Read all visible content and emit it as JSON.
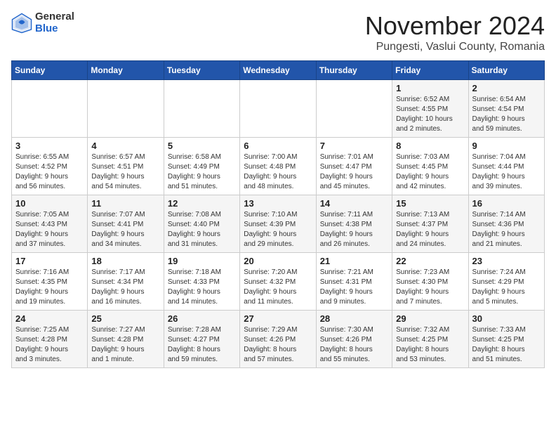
{
  "logo": {
    "general": "General",
    "blue": "Blue"
  },
  "title": "November 2024",
  "location": "Pungesti, Vaslui County, Romania",
  "weekdays": [
    "Sunday",
    "Monday",
    "Tuesday",
    "Wednesday",
    "Thursday",
    "Friday",
    "Saturday"
  ],
  "weeks": [
    [
      {
        "day": "",
        "info": ""
      },
      {
        "day": "",
        "info": ""
      },
      {
        "day": "",
        "info": ""
      },
      {
        "day": "",
        "info": ""
      },
      {
        "day": "",
        "info": ""
      },
      {
        "day": "1",
        "info": "Sunrise: 6:52 AM\nSunset: 4:55 PM\nDaylight: 10 hours\nand 2 minutes."
      },
      {
        "day": "2",
        "info": "Sunrise: 6:54 AM\nSunset: 4:54 PM\nDaylight: 9 hours\nand 59 minutes."
      }
    ],
    [
      {
        "day": "3",
        "info": "Sunrise: 6:55 AM\nSunset: 4:52 PM\nDaylight: 9 hours\nand 56 minutes."
      },
      {
        "day": "4",
        "info": "Sunrise: 6:57 AM\nSunset: 4:51 PM\nDaylight: 9 hours\nand 54 minutes."
      },
      {
        "day": "5",
        "info": "Sunrise: 6:58 AM\nSunset: 4:49 PM\nDaylight: 9 hours\nand 51 minutes."
      },
      {
        "day": "6",
        "info": "Sunrise: 7:00 AM\nSunset: 4:48 PM\nDaylight: 9 hours\nand 48 minutes."
      },
      {
        "day": "7",
        "info": "Sunrise: 7:01 AM\nSunset: 4:47 PM\nDaylight: 9 hours\nand 45 minutes."
      },
      {
        "day": "8",
        "info": "Sunrise: 7:03 AM\nSunset: 4:45 PM\nDaylight: 9 hours\nand 42 minutes."
      },
      {
        "day": "9",
        "info": "Sunrise: 7:04 AM\nSunset: 4:44 PM\nDaylight: 9 hours\nand 39 minutes."
      }
    ],
    [
      {
        "day": "10",
        "info": "Sunrise: 7:05 AM\nSunset: 4:43 PM\nDaylight: 9 hours\nand 37 minutes."
      },
      {
        "day": "11",
        "info": "Sunrise: 7:07 AM\nSunset: 4:41 PM\nDaylight: 9 hours\nand 34 minutes."
      },
      {
        "day": "12",
        "info": "Sunrise: 7:08 AM\nSunset: 4:40 PM\nDaylight: 9 hours\nand 31 minutes."
      },
      {
        "day": "13",
        "info": "Sunrise: 7:10 AM\nSunset: 4:39 PM\nDaylight: 9 hours\nand 29 minutes."
      },
      {
        "day": "14",
        "info": "Sunrise: 7:11 AM\nSunset: 4:38 PM\nDaylight: 9 hours\nand 26 minutes."
      },
      {
        "day": "15",
        "info": "Sunrise: 7:13 AM\nSunset: 4:37 PM\nDaylight: 9 hours\nand 24 minutes."
      },
      {
        "day": "16",
        "info": "Sunrise: 7:14 AM\nSunset: 4:36 PM\nDaylight: 9 hours\nand 21 minutes."
      }
    ],
    [
      {
        "day": "17",
        "info": "Sunrise: 7:16 AM\nSunset: 4:35 PM\nDaylight: 9 hours\nand 19 minutes."
      },
      {
        "day": "18",
        "info": "Sunrise: 7:17 AM\nSunset: 4:34 PM\nDaylight: 9 hours\nand 16 minutes."
      },
      {
        "day": "19",
        "info": "Sunrise: 7:18 AM\nSunset: 4:33 PM\nDaylight: 9 hours\nand 14 minutes."
      },
      {
        "day": "20",
        "info": "Sunrise: 7:20 AM\nSunset: 4:32 PM\nDaylight: 9 hours\nand 11 minutes."
      },
      {
        "day": "21",
        "info": "Sunrise: 7:21 AM\nSunset: 4:31 PM\nDaylight: 9 hours\nand 9 minutes."
      },
      {
        "day": "22",
        "info": "Sunrise: 7:23 AM\nSunset: 4:30 PM\nDaylight: 9 hours\nand 7 minutes."
      },
      {
        "day": "23",
        "info": "Sunrise: 7:24 AM\nSunset: 4:29 PM\nDaylight: 9 hours\nand 5 minutes."
      }
    ],
    [
      {
        "day": "24",
        "info": "Sunrise: 7:25 AM\nSunset: 4:28 PM\nDaylight: 9 hours\nand 3 minutes."
      },
      {
        "day": "25",
        "info": "Sunrise: 7:27 AM\nSunset: 4:28 PM\nDaylight: 9 hours\nand 1 minute."
      },
      {
        "day": "26",
        "info": "Sunrise: 7:28 AM\nSunset: 4:27 PM\nDaylight: 8 hours\nand 59 minutes."
      },
      {
        "day": "27",
        "info": "Sunrise: 7:29 AM\nSunset: 4:26 PM\nDaylight: 8 hours\nand 57 minutes."
      },
      {
        "day": "28",
        "info": "Sunrise: 7:30 AM\nSunset: 4:26 PM\nDaylight: 8 hours\nand 55 minutes."
      },
      {
        "day": "29",
        "info": "Sunrise: 7:32 AM\nSunset: 4:25 PM\nDaylight: 8 hours\nand 53 minutes."
      },
      {
        "day": "30",
        "info": "Sunrise: 7:33 AM\nSunset: 4:25 PM\nDaylight: 8 hours\nand 51 minutes."
      }
    ]
  ]
}
